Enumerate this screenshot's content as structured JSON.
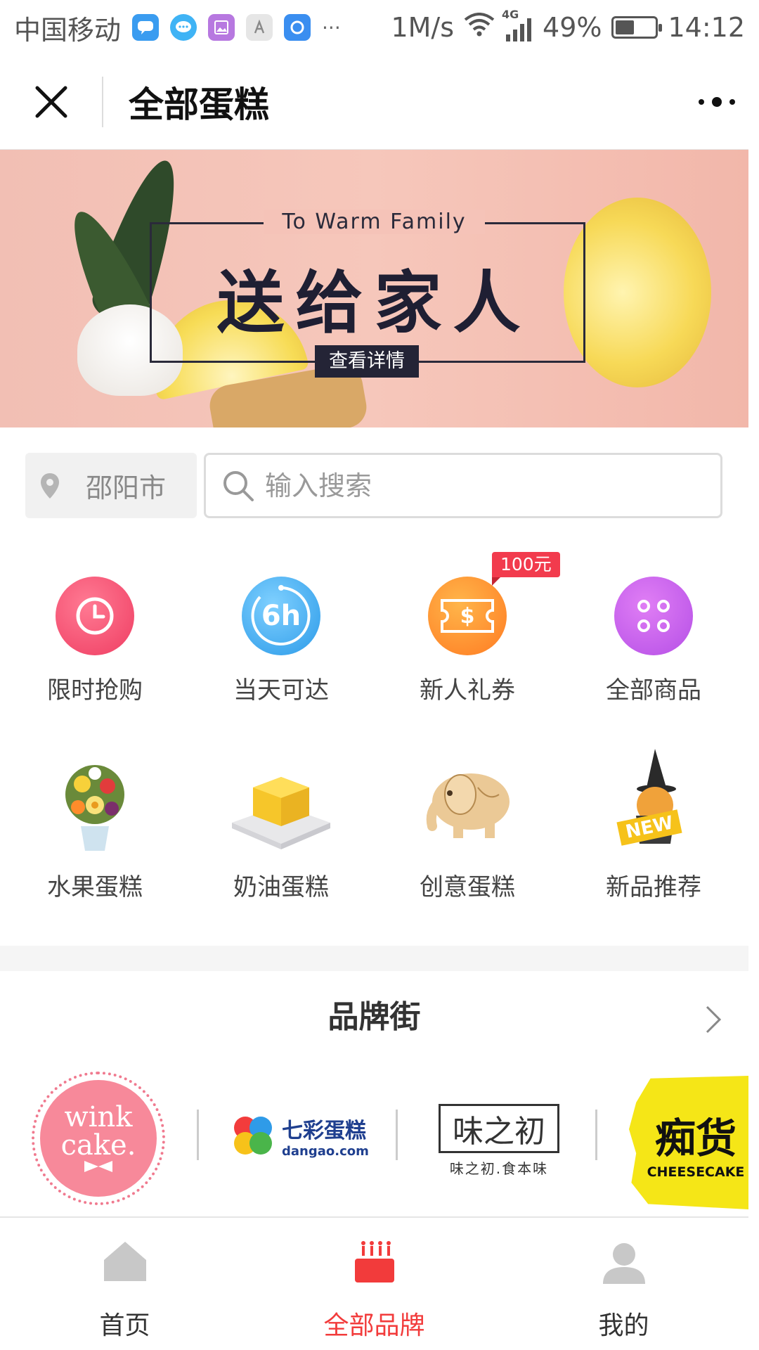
{
  "status_bar": {
    "carrier": "中国移动",
    "more": "···",
    "speed": "1M/s",
    "network": "4G",
    "battery_percent": "49%",
    "battery_level": 0.49,
    "time": "14:12"
  },
  "title_bar": {
    "title": "全部蛋糕"
  },
  "banner": {
    "subtitle": "To Warm Family",
    "headline": "送给家人",
    "button_label": "查看详情"
  },
  "location": {
    "city": "邵阳市"
  },
  "search": {
    "placeholder": "输入搜索"
  },
  "categories": [
    {
      "label": "限时抢购",
      "icon": "clock-icon",
      "color": "#f24a6a"
    },
    {
      "label": "当天可达",
      "icon": "six-hour-icon",
      "icon_text": "6h",
      "color": "#35a8ee"
    },
    {
      "label": "新人礼券",
      "icon": "coupon-icon",
      "icon_text": "$",
      "color": "#ff8a2b",
      "badge": "100元"
    },
    {
      "label": "全部商品",
      "icon": "grid-dots-icon",
      "color": "#c25ae8"
    },
    {
      "label": "水果蛋糕",
      "icon": "fruit-cake-image"
    },
    {
      "label": "奶油蛋糕",
      "icon": "cream-cake-image"
    },
    {
      "label": "创意蛋糕",
      "icon": "elephant-cake-image"
    },
    {
      "label": "新品推荐",
      "icon": "new-product-image",
      "icon_text": "NEW"
    }
  ],
  "brand_street": {
    "title": "品牌街",
    "brands": [
      {
        "name": "wink cake.",
        "line1": "wink",
        "line2": "cake."
      },
      {
        "name": "七彩蛋糕",
        "sub": "dangao.com"
      },
      {
        "name": "味之初",
        "sub": "味之初.食本味"
      },
      {
        "name": "痴货",
        "sub": "CHEESECAKE"
      }
    ]
  },
  "bottom_nav": [
    {
      "label": "首页",
      "icon": "home-icon",
      "active": false
    },
    {
      "label": "全部品牌",
      "icon": "cake-icon",
      "active": true
    },
    {
      "label": "我的",
      "icon": "user-icon",
      "active": false
    }
  ],
  "colors": {
    "accent": "#f23b3b",
    "banner_bg": "#f4c2b6"
  }
}
